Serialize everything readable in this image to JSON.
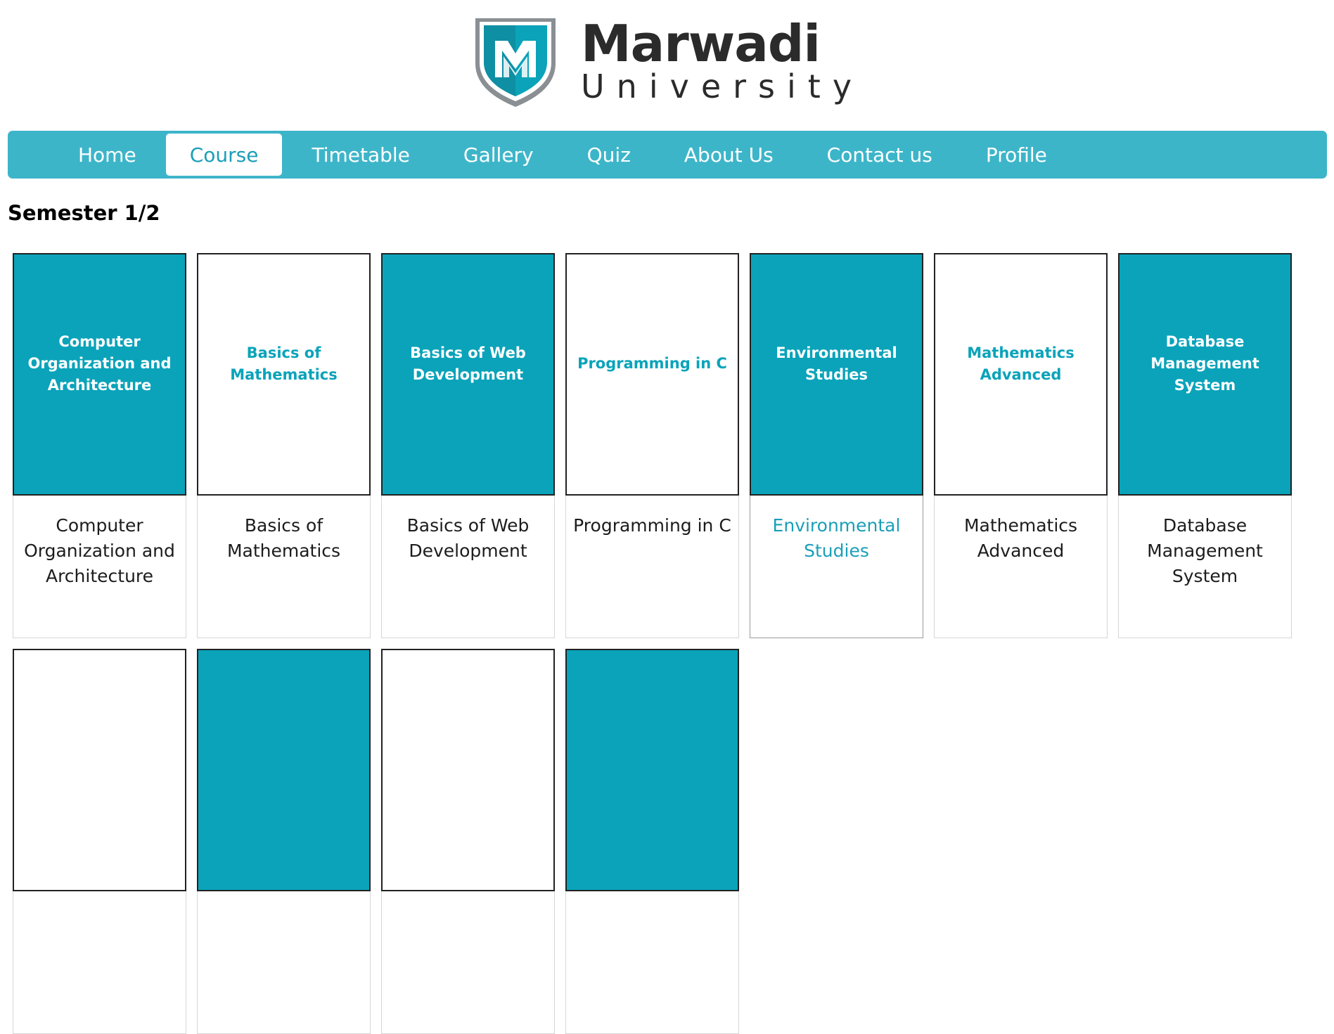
{
  "brand": {
    "name_line1": "Marwadi",
    "name_line2": "University",
    "colors": {
      "teal": "#0aa3ba",
      "nav": "#3db5c9",
      "shield_dark": "#0f7f8f",
      "text": "#2b2b2b"
    }
  },
  "nav": {
    "items": [
      {
        "label": "Home"
      },
      {
        "label": "Course"
      },
      {
        "label": "Timetable"
      },
      {
        "label": "Gallery"
      },
      {
        "label": "Quiz"
      },
      {
        "label": "About Us"
      },
      {
        "label": "Contact us"
      },
      {
        "label": "Profile"
      }
    ],
    "active": "Course"
  },
  "section": {
    "title": "Semester 1/2"
  },
  "courses": [
    {
      "thumb": "Computer Organization and Architecture",
      "label": "Computer Organization and Architecture",
      "style": "teal"
    },
    {
      "thumb": "Basics of Mathematics",
      "label": "Basics of Mathematics",
      "style": "white"
    },
    {
      "thumb": "Basics of Web Development",
      "label": "Basics of Web Development",
      "style": "teal"
    },
    {
      "thumb": "Programming in C",
      "label": "Programming in C",
      "style": "white"
    },
    {
      "thumb": "Environmental Studies",
      "label": "Environmental Studies",
      "style": "teal",
      "hovered": true
    },
    {
      "thumb": "Mathematics Advanced",
      "label": "Mathematics Advanced",
      "style": "white"
    },
    {
      "thumb": "Database Management System",
      "label": "Database Management System",
      "style": "teal"
    },
    {
      "thumb": "",
      "label": "",
      "style": "white"
    },
    {
      "thumb": "",
      "label": "",
      "style": "teal"
    },
    {
      "thumb": "",
      "label": "",
      "style": "white"
    },
    {
      "thumb": "",
      "label": "",
      "style": "teal"
    }
  ]
}
